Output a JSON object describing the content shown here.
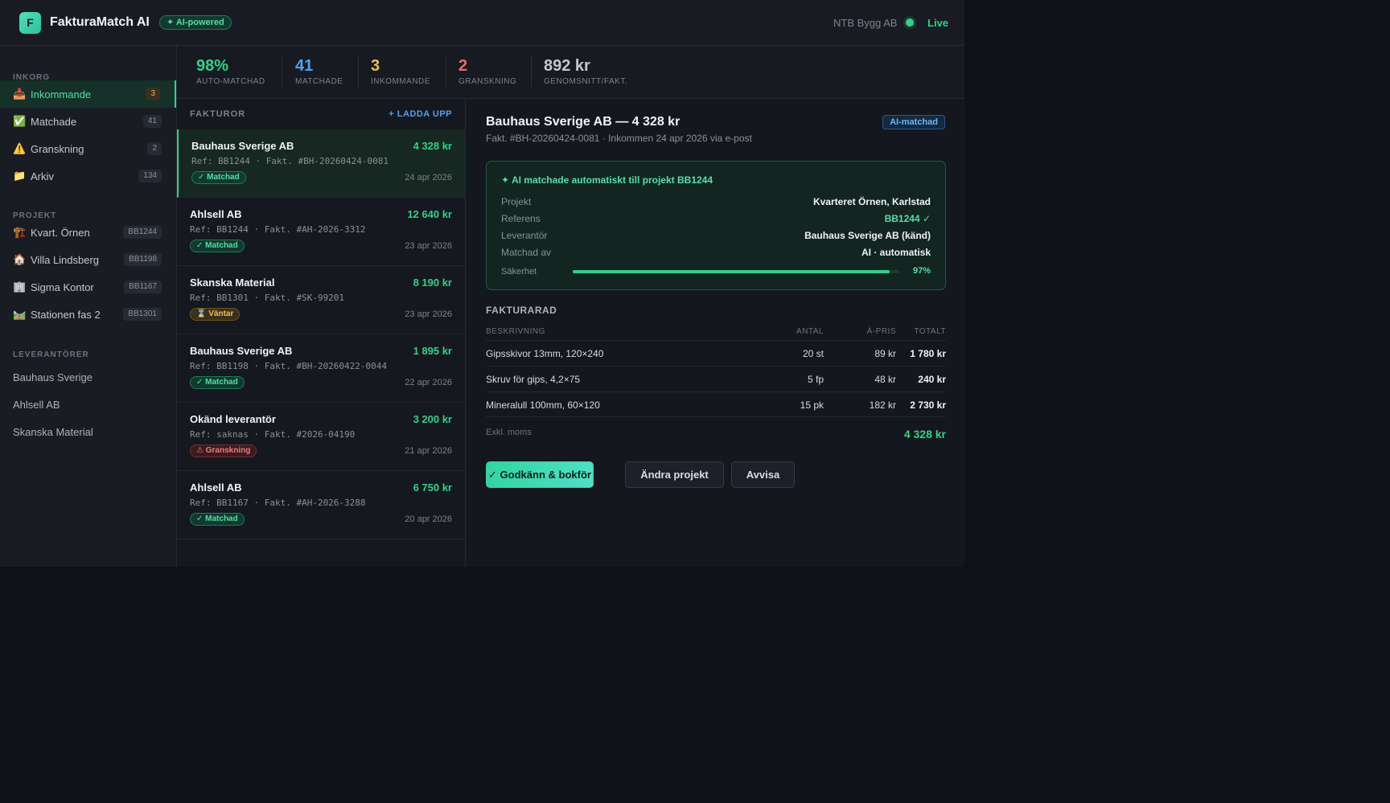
{
  "header": {
    "logo_letter": "F",
    "app_title": "FakturaMatch AI",
    "ai_badge": "✦ AI-powered",
    "company": "NTB Bygg AB",
    "live_label": "Live"
  },
  "sidebar": {
    "inbox_label": "INKORG",
    "inbox_items": [
      {
        "icon": "📥",
        "label": "Inkommande",
        "count": "3"
      },
      {
        "icon": "✅",
        "label": "Matchade",
        "count": "41"
      },
      {
        "icon": "⚠️",
        "label": "Granskning",
        "count": "2"
      },
      {
        "icon": "📁",
        "label": "Arkiv",
        "count": "134"
      }
    ],
    "projects_label": "PROJEKT",
    "projects": [
      {
        "icon": "🏗️",
        "label": "Kvart. Örnen",
        "code": "BB1244"
      },
      {
        "icon": "🏠",
        "label": "Villa Lindsberg",
        "code": "BB1198"
      },
      {
        "icon": "🏢",
        "label": "Sigma Kontor",
        "code": "BB1167"
      },
      {
        "icon": "🛤️",
        "label": "Stationen fas 2",
        "code": "BB1301"
      }
    ],
    "suppliers_label": "LEVERANTÖRER",
    "suppliers": [
      "Bauhaus Sverige",
      "Ahlsell AB",
      "Skanska Material"
    ]
  },
  "stats": [
    {
      "value": "98%",
      "label": "AUTO-MATCHAD",
      "color": "#2bd48a"
    },
    {
      "value": "41",
      "label": "MATCHADE",
      "color": "#4fa3f0"
    },
    {
      "value": "3",
      "label": "INKOMMANDE",
      "color": "#f0c04a"
    },
    {
      "value": "2",
      "label": "GRANSKNING",
      "color": "#f06a6a"
    },
    {
      "value": "892 kr",
      "label": "GENOMSNITT/FAKT.",
      "color": "#c4c8cf"
    }
  ],
  "list": {
    "heading": "FAKTUROR",
    "upload_label": "+ LADDA UPP",
    "invoices": [
      {
        "name": "Bauhaus Sverige AB",
        "amount": "4 328 kr",
        "ref": "Ref: BB1244 · Fakt. #BH-20260424-0081",
        "status": "✓ Matchad",
        "date": "24 apr 2026"
      },
      {
        "name": "Ahlsell AB",
        "amount": "12 640 kr",
        "ref": "Ref: BB1244 · Fakt. #AH-2026-3312",
        "status": "✓ Matchad",
        "date": "23 apr 2026"
      },
      {
        "name": "Skanska Material",
        "amount": "8 190 kr",
        "ref": "Ref: BB1301 · Fakt. #SK-99201",
        "status": "⌛ Väntar",
        "date": "23 apr 2026"
      },
      {
        "name": "Bauhaus Sverige AB",
        "amount": "1 895 kr",
        "ref": "Ref: BB1198 · Fakt. #BH-20260422-0044",
        "status": "✓ Matchad",
        "date": "22 apr 2026"
      },
      {
        "name": "Okänd leverantör",
        "amount": "3 200 kr",
        "ref": "Ref: saknas · Fakt. #2026-04190",
        "status": "⚠ Granskning",
        "date": "21 apr 2026"
      },
      {
        "name": "Ahlsell AB",
        "amount": "6 750 kr",
        "ref": "Ref: BB1167 · Fakt. #AH-2026-3288",
        "status": "✓ Matchad",
        "date": "20 apr 2026"
      }
    ]
  },
  "detail": {
    "title": "Bauhaus Sverige AB — 4 328 kr",
    "badge": "AI-matchad",
    "subtitle": "Fakt. #BH-20260424-0081 · Inkommen 24 apr 2026 via e-post",
    "ai_heading": "✦ AI matchade automatiskt till projekt BB1244",
    "fields": [
      {
        "key": "Projekt",
        "value": "Kvarteret Örnen, Karlstad"
      },
      {
        "key": "Referens",
        "value": "BB1244 ✓"
      },
      {
        "key": "Leverantör",
        "value": "Bauhaus Sverige AB (känd)"
      },
      {
        "key": "Matchad av",
        "value": "AI · automatisk"
      }
    ],
    "confidence_label": "Säkerhet",
    "confidence_value": "97%",
    "confidence_fraction": 0.97,
    "lines_heading": "FAKTURARAD",
    "columns": [
      "BESKRIVNING",
      "ANTAL",
      "À-PRIS",
      "TOTALT"
    ],
    "lines": [
      {
        "desc": "Gipsskivor 13mm, 120×240",
        "qty": "20 st",
        "price": "89 kr",
        "total": "1 780 kr"
      },
      {
        "desc": "Skruv för gips, 4,2×75",
        "qty": "5 fp",
        "price": "48 kr",
        "total": "240 kr"
      },
      {
        "desc": "Mineralull 100mm, 60×120",
        "qty": "15 pk",
        "price": "182 kr",
        "total": "2 730 kr"
      }
    ],
    "excl_label": "Exkl. moms",
    "grand_total": "4 328 kr",
    "approve_label": "✓ Godkänn & bokför",
    "change_label": "Ändra projekt",
    "reject_label": "Avvisa"
  }
}
